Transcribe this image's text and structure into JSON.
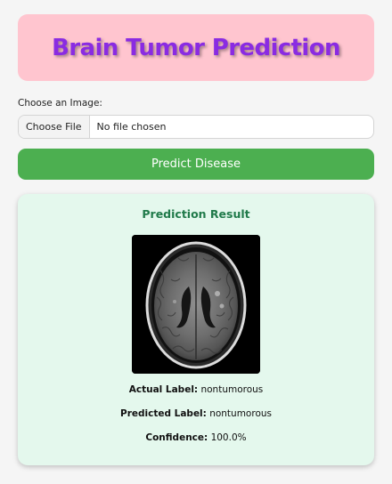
{
  "header": {
    "title": "Brain Tumor Prediction",
    "background": "#ffc5cf",
    "title_color": "#8a2be2"
  },
  "upload": {
    "label": "Choose an Image:",
    "button_label": "Choose File",
    "status": "No file chosen"
  },
  "predict_button": {
    "label": "Predict Disease",
    "color": "#4caf50"
  },
  "result": {
    "title": "Prediction Result",
    "image_alt": "brain MRI scan",
    "actual_label_key": "Actual Label:",
    "actual_label_value": "nontumorous",
    "predicted_label_key": "Predicted Label:",
    "predicted_label_value": "nontumorous",
    "confidence_key": "Confidence:",
    "confidence_value": "100.0%",
    "background": "#e4f8ed",
    "title_color": "#207a4a"
  }
}
